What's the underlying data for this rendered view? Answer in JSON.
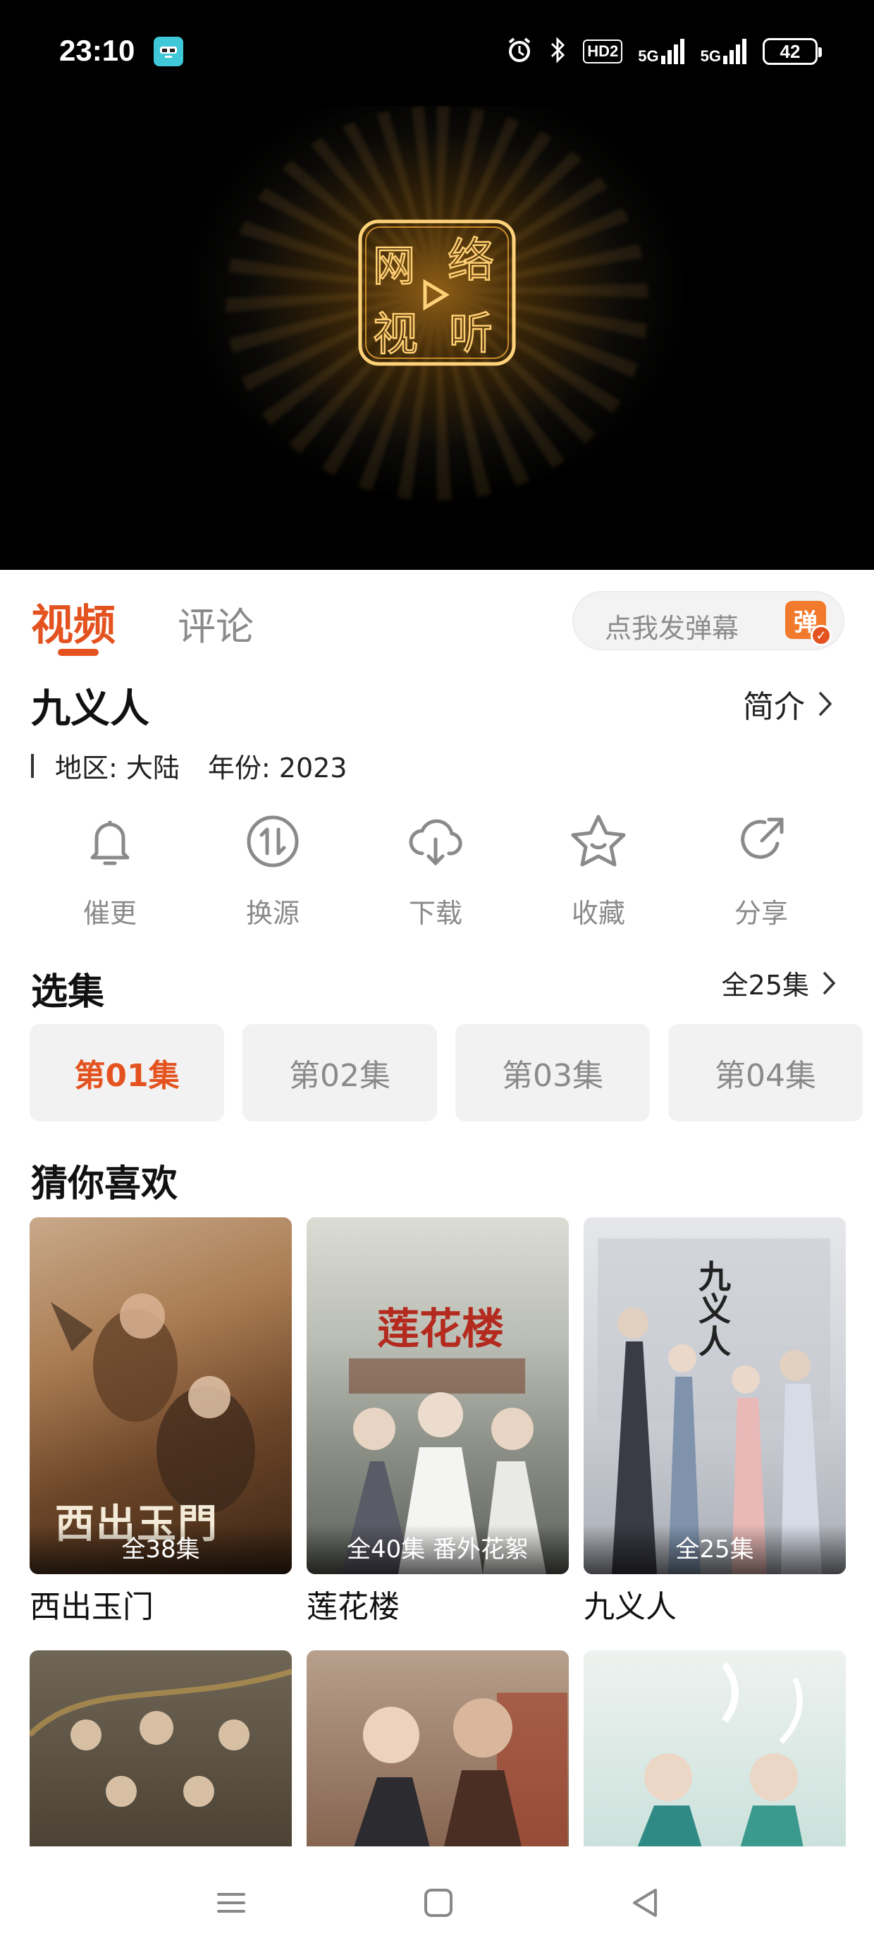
{
  "status_bar": {
    "time": "23:10",
    "battery": "42",
    "signal_1": "5G",
    "signal_2": "5G",
    "hd_badge": "HD2",
    "icons": [
      "app-badge-icon",
      "alarm-icon",
      "bluetooth-icon",
      "hd-icon",
      "signal-icon",
      "signal-icon",
      "battery-icon"
    ]
  },
  "player": {
    "logo_text": [
      "网",
      "络",
      "视",
      "听"
    ]
  },
  "tabs": {
    "video": "视频",
    "comments": "评论",
    "danmu_placeholder": "点我发弹幕",
    "danmu_icon": "弹"
  },
  "show": {
    "title": "九义人",
    "intro_label": "简介",
    "region": "地区: 大陆",
    "year": "年份: 2023"
  },
  "actions": [
    {
      "label": "催更",
      "icon": "bell-icon"
    },
    {
      "label": "换源",
      "icon": "switch-source-icon"
    },
    {
      "label": "下载",
      "icon": "download-icon"
    },
    {
      "label": "收藏",
      "icon": "star-icon"
    },
    {
      "label": "分享",
      "icon": "share-icon"
    }
  ],
  "episodes": {
    "section_title": "选集",
    "all_label": "全25集",
    "items": [
      "第01集",
      "第02集",
      "第03集",
      "第04集"
    ],
    "selected_index": 0
  },
  "recommend": {
    "section_title": "猜你喜欢",
    "items": [
      {
        "name": "西出玉门",
        "episodes": "全38集",
        "poster_text": "西出玉門"
      },
      {
        "name": "莲花楼",
        "episodes": "全40集 番外花絮",
        "poster_text": "莲花楼"
      },
      {
        "name": "九义人",
        "episodes": "全25集",
        "poster_text": "九义人"
      },
      {
        "name": "",
        "episodes": "",
        "poster_text": ""
      },
      {
        "name": "",
        "episodes": "",
        "poster_text": ""
      },
      {
        "name": "",
        "episodes": "",
        "poster_text": ""
      }
    ]
  },
  "navbar": {
    "icons": [
      "menu-icon",
      "home-icon",
      "back-icon"
    ]
  },
  "colors": {
    "accent": "#e4531f",
    "danmu_orange": "#f27a2c",
    "muted": "#8a8a8a"
  }
}
